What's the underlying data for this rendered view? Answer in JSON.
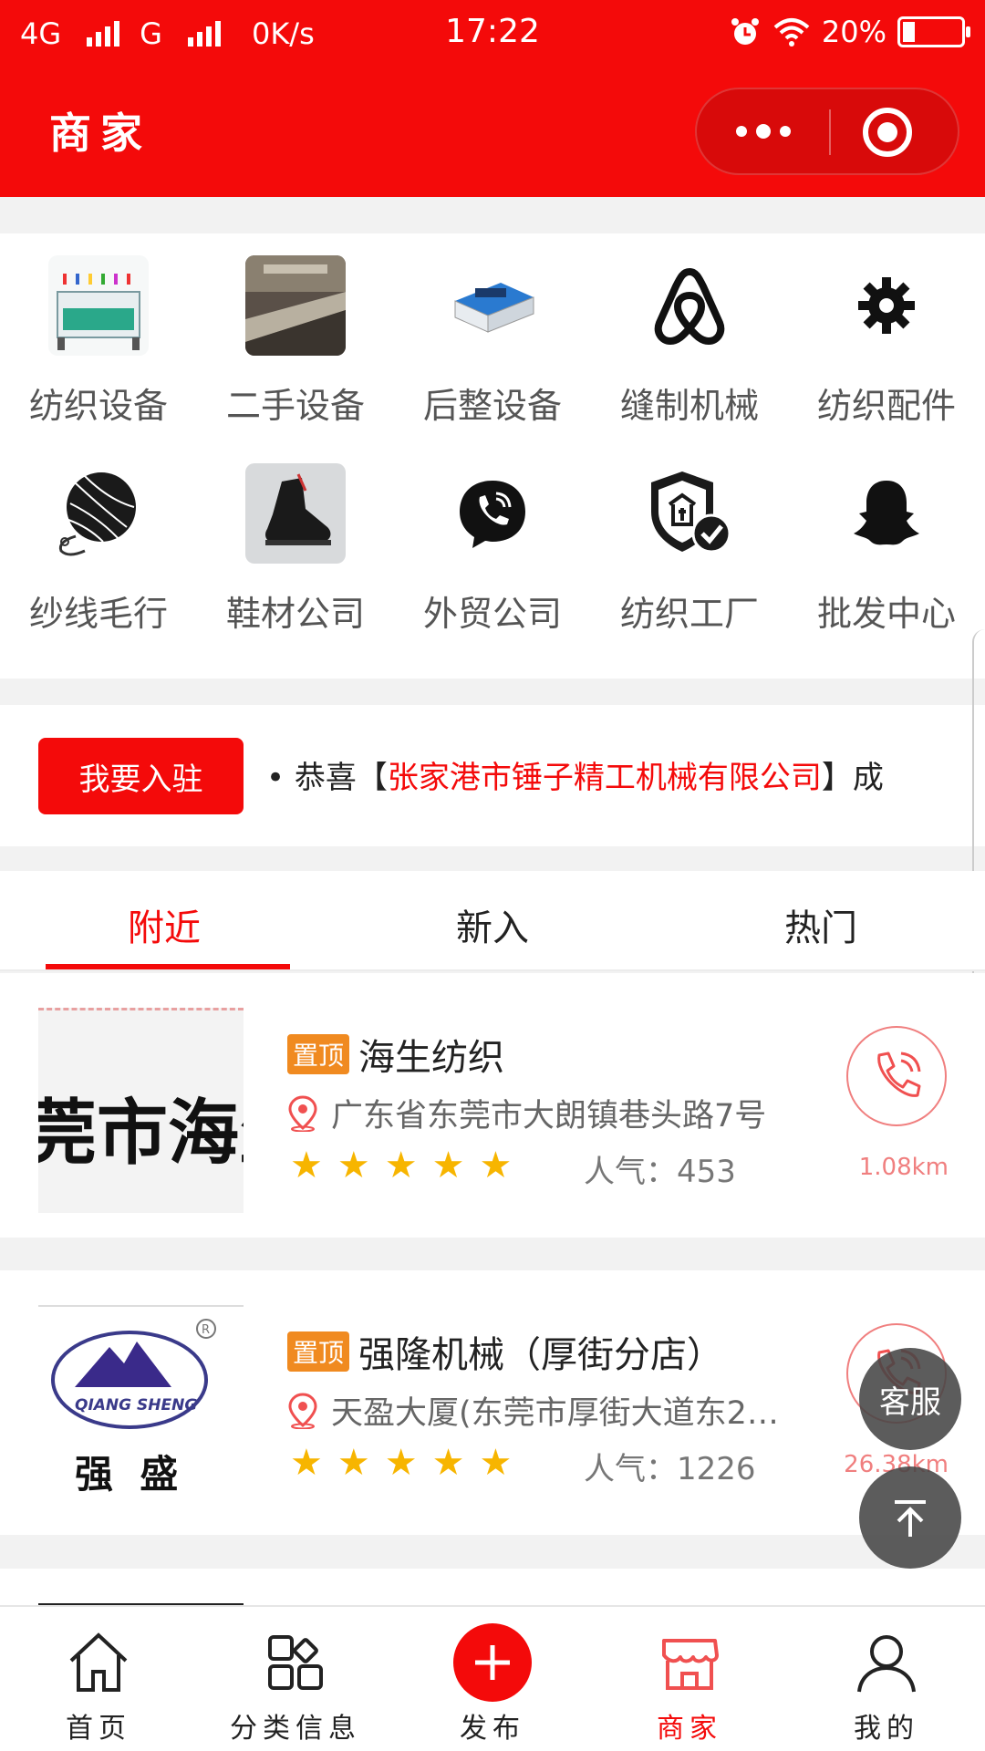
{
  "status_bar": {
    "network1": "4G",
    "network2": "G",
    "speed": "0K/s",
    "time": "17:22",
    "battery": "20%",
    "battery_level": 0.2
  },
  "header": {
    "title": "商家"
  },
  "categories": [
    {
      "label": "纺织设备",
      "icon": "textile-machine-photo"
    },
    {
      "label": "二手设备",
      "icon": "factory-photo"
    },
    {
      "label": "后整设备",
      "icon": "finishing-machine-photo"
    },
    {
      "label": "缝制机械",
      "icon": "airbnb-icon"
    },
    {
      "label": "纺织配件",
      "icon": "gear-icon"
    },
    {
      "label": "纱线毛行",
      "icon": "yarn-ball-icon"
    },
    {
      "label": "鞋材公司",
      "icon": "shoe-photo"
    },
    {
      "label": "外贸公司",
      "icon": "phone-chat-icon"
    },
    {
      "label": "纺织工厂",
      "icon": "shield-check-icon"
    },
    {
      "label": "批发中心",
      "icon": "ghost-icon"
    }
  ],
  "join": {
    "button": "我要入驻",
    "notice_prefix": "• 恭喜【",
    "notice_company": "张家港市锤子精工机械有限公司",
    "notice_suffix": "】成"
  },
  "tabs": [
    {
      "label": "附近",
      "active": true
    },
    {
      "label": "新入",
      "active": false
    },
    {
      "label": "热门",
      "active": false
    }
  ],
  "merchants": [
    {
      "tag": "置顶",
      "name": "海生纺织",
      "address": "广东省东莞市大朗镇巷头路7号",
      "rating": 5,
      "popularity": "人气：453",
      "distance": "1.08km",
      "logo_text": "莞市海生"
    },
    {
      "tag": "置顶",
      "name": "强隆机械（厚街分店）",
      "address": "天盈大厦(东莞市厚街大道东2…",
      "rating": 5,
      "popularity": "人气：1226",
      "distance": "26.38km",
      "logo_text": "强  盛",
      "logo_sub": "QIANG SHENG"
    }
  ],
  "floating": {
    "service": "客服"
  },
  "tabbar": [
    {
      "label": "首页",
      "icon": "home-icon"
    },
    {
      "label": "分类信息",
      "icon": "grid-icon"
    },
    {
      "label": "发布",
      "icon": "plus-icon"
    },
    {
      "label": "商家",
      "icon": "shop-icon",
      "active": true
    },
    {
      "label": "我的",
      "icon": "user-icon"
    }
  ],
  "colors": {
    "brand": "#f40a0a",
    "tag": "#f08a20",
    "star": "#f7b500"
  }
}
